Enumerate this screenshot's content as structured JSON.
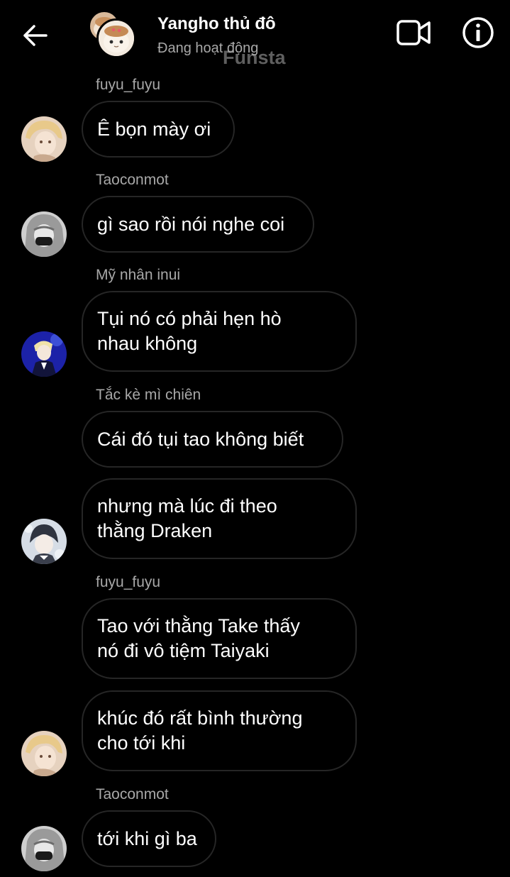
{
  "header": {
    "title": "Yangho thủ đô",
    "status": "Đang hoạt động",
    "watermark": "Funsta"
  },
  "colors": {
    "background": "#000000",
    "bubble_border": "#262626",
    "secondary_text": "#a8a8a8"
  },
  "messages": [
    {
      "sender": "fuyu_fuyu",
      "lines": [
        "Ê bọn mày ơi"
      ]
    },
    {
      "sender": "Taoconmot",
      "lines": [
        "gì sao rồi nói nghe coi"
      ]
    },
    {
      "sender": "Mỹ nhân inui",
      "lines": [
        "Tụi nó có phải hẹn hò",
        "nhau không"
      ]
    },
    {
      "sender": "Tắc kè mì chiên",
      "lines": [
        "Cái đó tụi tao không biết"
      ]
    },
    {
      "sender": "",
      "lines": [
        "nhưng mà lúc đi theo",
        "thằng Draken"
      ]
    },
    {
      "sender": "fuyu_fuyu",
      "lines": [
        "Tao với thằng Take thấy",
        "nó đi vô tiệm Taiyaki"
      ]
    },
    {
      "sender": "",
      "lines": [
        "khúc đó rất bình thường",
        "cho tới khi"
      ]
    },
    {
      "sender": "Taoconmot",
      "lines": [
        "tới khi gì ba"
      ]
    }
  ]
}
